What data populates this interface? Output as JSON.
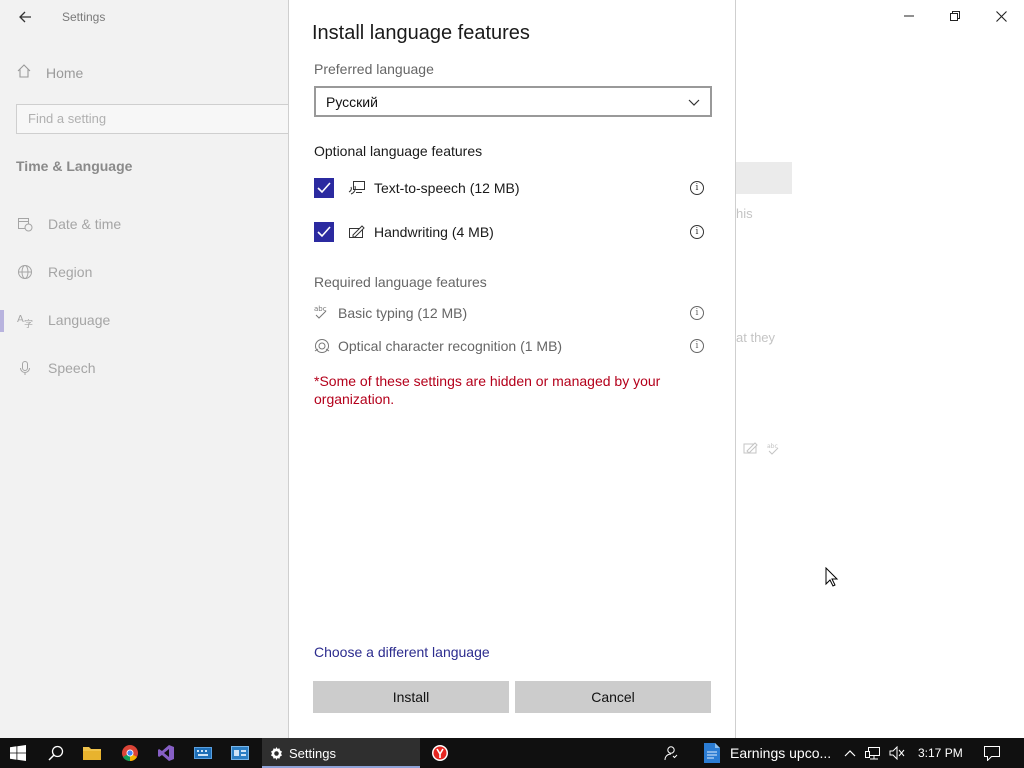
{
  "settings_window": {
    "app_title": "Settings",
    "home_label": "Home",
    "search_placeholder": "Find a setting",
    "section_heading": "Time & Language",
    "nav_items": [
      {
        "label": "Date & time",
        "icon": "calendar-clock-icon"
      },
      {
        "label": "Region",
        "icon": "globe-icon"
      },
      {
        "label": "Language",
        "icon": "language-icon",
        "selected": true
      },
      {
        "label": "Speech",
        "icon": "microphone-icon"
      }
    ],
    "background_fragments": {
      "frag_1": "his",
      "frag_2": "at they"
    }
  },
  "dialog": {
    "title": "Install language features",
    "preferred_label": "Preferred language",
    "preferred_value": "Русский",
    "optional_heading": "Optional language features",
    "optional_features": [
      {
        "label": "Text-to-speech (12 MB)",
        "checked": true,
        "icon": "text-to-speech-icon"
      },
      {
        "label": "Handwriting (4 MB)",
        "checked": true,
        "icon": "handwriting-icon"
      }
    ],
    "required_heading": "Required language features",
    "required_features": [
      {
        "label": "Basic typing (12 MB)",
        "icon": "basic-typing-icon"
      },
      {
        "label": "Optical character recognition (1 MB)",
        "icon": "ocr-icon"
      }
    ],
    "warning": "*Some of these settings are hidden or managed by your organization.",
    "link_label": "Choose a different language",
    "install_label": "Install",
    "cancel_label": "Cancel"
  },
  "taskbar": {
    "settings_label": "Settings",
    "earnings_label": "Earnings upco...",
    "clock": "3:17 PM"
  },
  "colors": {
    "checkbox": "#2b2aa0",
    "warning": "#b4001b",
    "link": "#2c2c8e",
    "button": "#cccccc",
    "taskbar": "#101010"
  }
}
